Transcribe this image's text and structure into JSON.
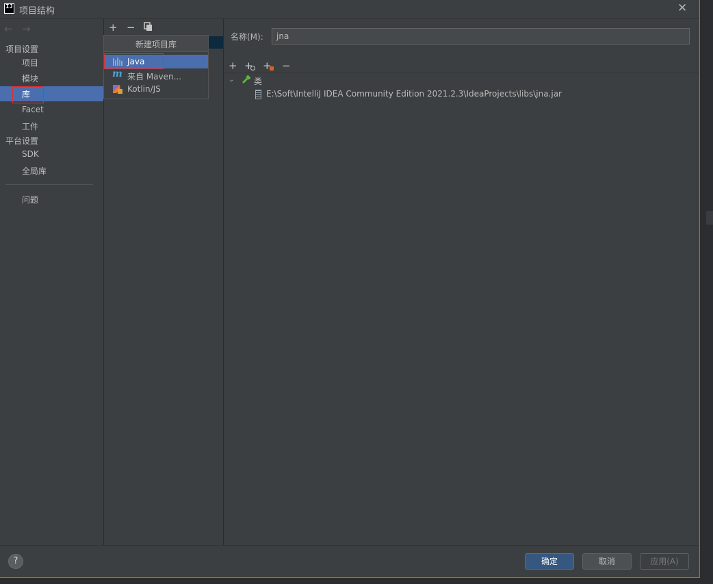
{
  "window": {
    "title": "项目结构",
    "app_icon_text": "IJ"
  },
  "nav": {
    "back_arrow": "←",
    "forward_arrow": "→",
    "section_project": "项目设置",
    "items_project": [
      {
        "label": "项目"
      },
      {
        "label": "模块"
      },
      {
        "label": "库"
      },
      {
        "label": "Facet"
      },
      {
        "label": "工件"
      }
    ],
    "section_platform": "平台设置",
    "items_platform": [
      {
        "label": "SDK"
      },
      {
        "label": "全局库"
      }
    ],
    "problems": "问题"
  },
  "library_toolbar": {
    "add": "+",
    "remove": "−",
    "copy_icon": "copy-icon"
  },
  "new_library_popup": {
    "header": "新建项目库",
    "items": [
      {
        "label": "Java",
        "icon": "java-library-icon"
      },
      {
        "label": "来自 Maven...",
        "icon": "maven-icon"
      },
      {
        "label": "Kotlin/JS",
        "icon": "kotlin-js-icon"
      }
    ]
  },
  "details": {
    "name_label": "名称(M):",
    "name_value": "jna",
    "toolbar": {
      "add": "+",
      "add_with_attachment": "+",
      "add_excluded": "+",
      "remove": "−"
    },
    "tree": {
      "root_label": "类",
      "child_path": "E:\\Soft\\IntelliJ IDEA Community Edition 2021.2.3\\IdeaProjects\\libs\\jna.jar"
    }
  },
  "footer": {
    "help": "?",
    "ok": "确定",
    "cancel": "取消",
    "apply": "应用(A)"
  },
  "colors": {
    "background": "#3c3f41",
    "selection": "#4b6eaf",
    "highlight_box": "#e03030",
    "primary_button": "#365880"
  }
}
